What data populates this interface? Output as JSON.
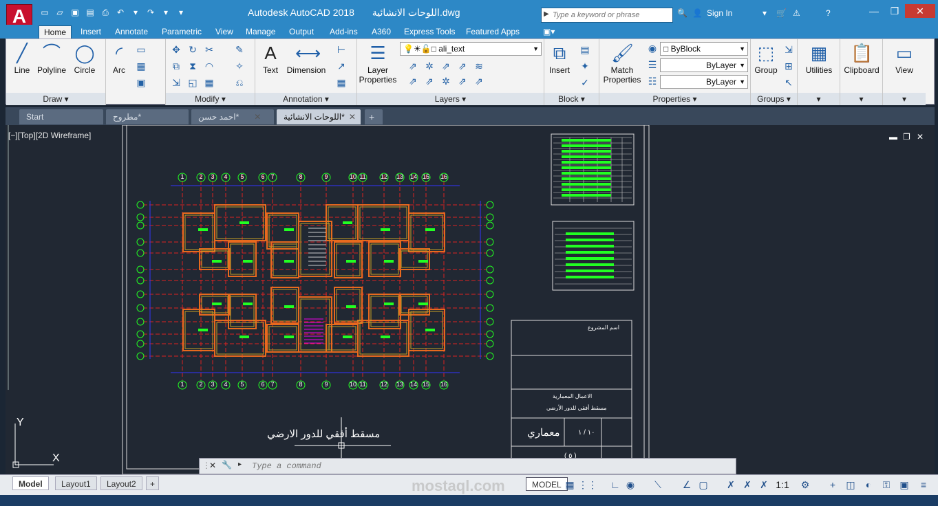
{
  "window": {
    "app_logo": "A",
    "title": "Autodesk AutoCAD 2018",
    "file": "اللوحات الانشائية.dwg",
    "search_placeholder": "Type a keyword or phrase",
    "sign_in": "Sign In"
  },
  "ribbon_tabs": [
    "Home",
    "Insert",
    "Annotate",
    "Parametric",
    "View",
    "Manage",
    "Output",
    "Add-ins",
    "A360",
    "Express Tools",
    "Featured Apps"
  ],
  "draw_panel": {
    "title": "Draw",
    "tools": [
      "Line",
      "Polyline",
      "Circle",
      "Arc"
    ]
  },
  "modify_panel": {
    "title": "Modify"
  },
  "annotation_panel": {
    "title": "Annotation",
    "tools": [
      "Text",
      "Dimension"
    ]
  },
  "layers_panel": {
    "title": "Layers",
    "layer_properties": "Layer Properties",
    "current_layer": "ali_text"
  },
  "block_panel": {
    "title": "Block",
    "insert": "Insert"
  },
  "properties_panel": {
    "title": "Properties",
    "match": "Match Properties",
    "color": "ByBlock",
    "linetype": "ByLayer",
    "lineweight": "ByLayer"
  },
  "groups_panel": {
    "title": "Groups",
    "group": "Group"
  },
  "utilities": "Utilities",
  "clipboard": "Clipboard",
  "view_panel": "View",
  "document_tabs": [
    {
      "label": "Start",
      "active": false
    },
    {
      "label": "مطروح*",
      "active": false
    },
    {
      "label": "احمد حسن*",
      "active": false
    },
    {
      "label": "اللوحات الانشائية*",
      "active": true
    }
  ],
  "viewport": {
    "label": "[−][Top][2D Wireframe]",
    "plan_caption": "مسقط أفقي للدور الارضي",
    "grid_numbers": [
      "1",
      "2",
      "3",
      "4",
      "5",
      "6",
      "7",
      "8",
      "9",
      "10",
      "11",
      "12",
      "13",
      "14",
      "15",
      "16"
    ],
    "title_block": {
      "project_label": "اسم المشروع",
      "dept": "الاعمال المعمارية",
      "drawing": "مسقط أفقي للدور الأرضي",
      "discipline": "معماري",
      "sheet": "١٠ / ١",
      "sheet_no": "( ٥ )"
    },
    "ucs_y": "Y",
    "ucs_x": "X"
  },
  "command_line": {
    "placeholder": "Type a command"
  },
  "layout_tabs": [
    "Model",
    "Layout1",
    "Layout2"
  ],
  "status": {
    "model": "MODEL",
    "scale": "1:1"
  },
  "watermark": "mostaql.com"
}
